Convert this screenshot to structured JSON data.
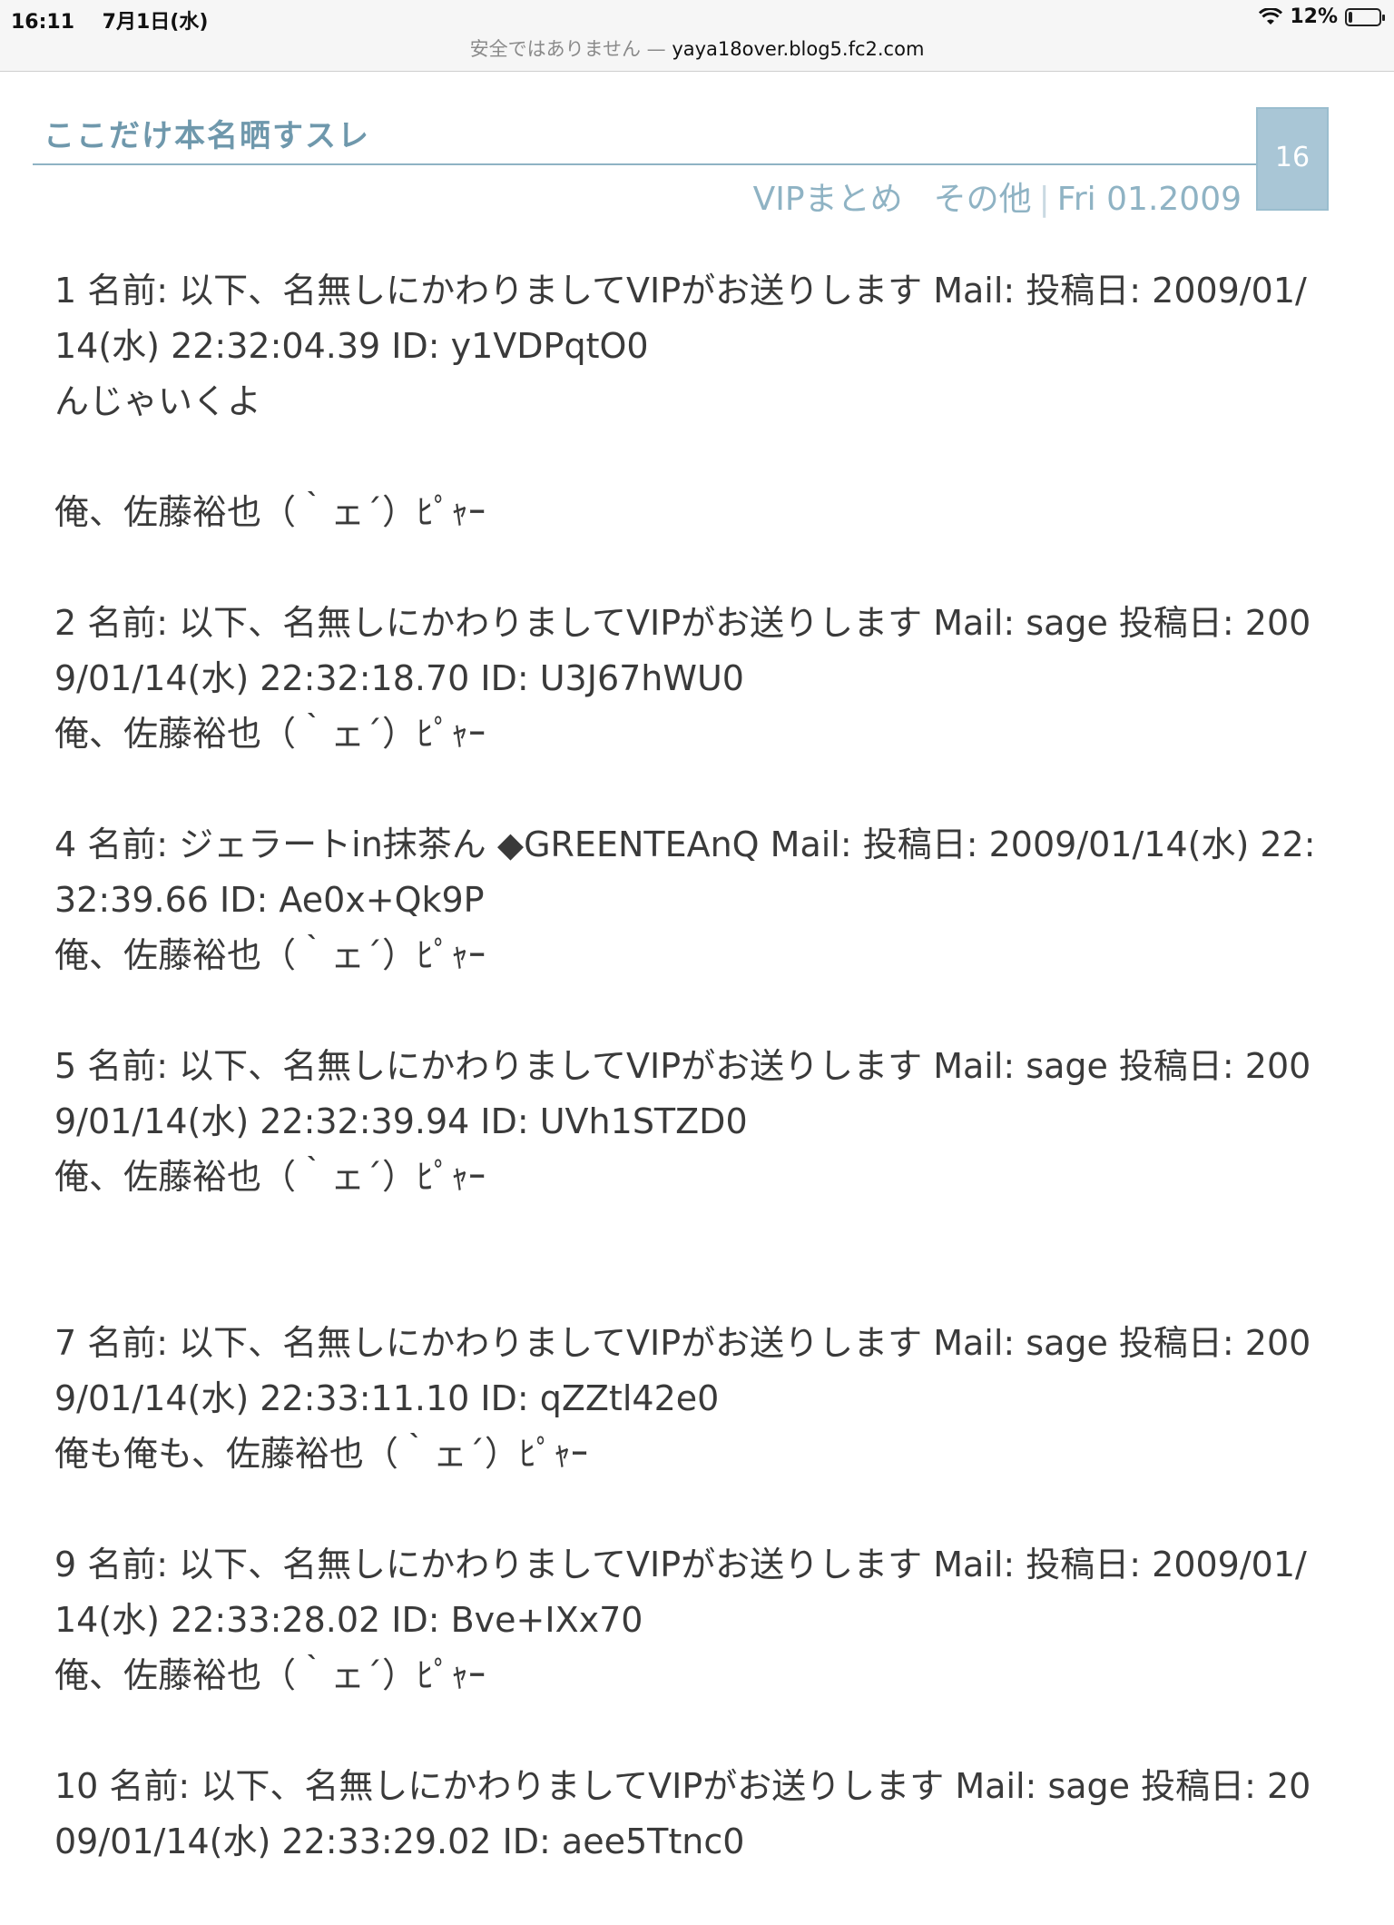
{
  "status": {
    "time": "16:11",
    "date": "7月1日(水)",
    "battery": "12%",
    "battery_level": 0.12
  },
  "browser": {
    "insecure_label": "安全ではありません —",
    "domain": "yaya18over.blog5.fc2.com"
  },
  "entry": {
    "title": "ここだけ本名晒すスレ",
    "day": "16",
    "category_1": "VIPまとめ",
    "category_2": "その他",
    "date": "Fri 01.2009"
  },
  "posts": [
    {
      "head": "1 名前: 以下、名無しにかわりましてVIPがお送りします Mail: 投稿日: 2009/01/14(水) 22:32:04.39 ID: y1VDPqtO0",
      "lines": [
        "んじゃいくよ",
        "",
        "俺、佐藤裕也（｀ェ´）ﾋﾟｬｰ"
      ]
    },
    {
      "head": "2 名前: 以下、名無しにかわりましてVIPがお送りします Mail: sage 投稿日: 2009/01/14(水) 22:32:18.70 ID: U3J67hWU0",
      "lines": [
        "俺、佐藤裕也（｀ェ´）ﾋﾟｬｰ"
      ]
    },
    {
      "head": "4 名前: ジェラートin抹茶ん ◆GREENTEAnQ Mail: 投稿日: 2009/01/14(水) 22:32:39.66 ID: Ae0x+Qk9P",
      "lines": [
        "俺、佐藤裕也（｀ェ´）ﾋﾟｬｰ"
      ]
    },
    {
      "head": "5 名前: 以下、名無しにかわりましてVIPがお送りします Mail: sage 投稿日: 2009/01/14(水) 22:32:39.94 ID: UVh1STZD0",
      "lines": [
        "俺、佐藤裕也（｀ェ´）ﾋﾟｬｰ"
      ]
    },
    {
      "head": "7 名前: 以下、名無しにかわりましてVIPがお送りします Mail: sage 投稿日: 2009/01/14(水) 22:33:11.10 ID: qZZtl42e0",
      "lines": [
        "俺も俺も、佐藤裕也（｀ェ´）ﾋﾟｬｰ"
      ]
    },
    {
      "head": "9 名前: 以下、名無しにかわりましてVIPがお送りします Mail: 投稿日: 2009/01/14(水) 22:33:28.02 ID: Bve+IXx70",
      "lines": [
        "俺、佐藤裕也（｀ェ´）ﾋﾟｬｰ"
      ]
    },
    {
      "head": "10 名前: 以下、名無しにかわりましてVIPがお送りします Mail: sage 投稿日: 2009/01/14(水) 22:33:29.02 ID: aee5Ttnc0",
      "lines": []
    }
  ]
}
